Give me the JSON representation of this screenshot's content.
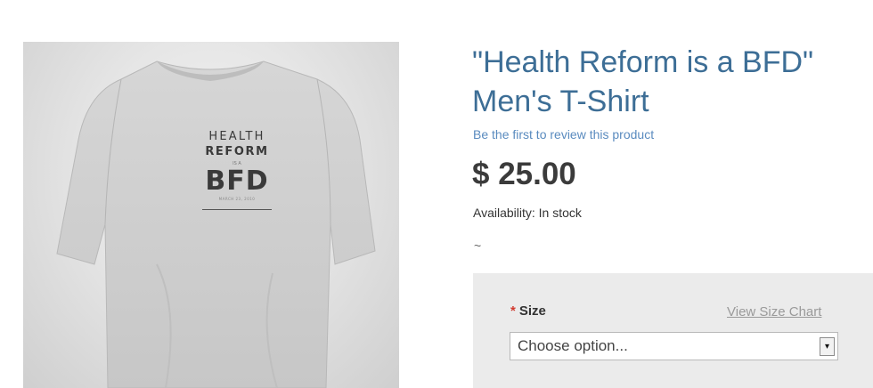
{
  "product": {
    "title_line1": "\"Health Reform is a BFD\"",
    "title_line2": "Men's T-Shirt",
    "review_link": "Be the first to review this product",
    "price": "$ 25.00",
    "availability": "Availability: In stock",
    "tilde": "~"
  },
  "shirt_print": {
    "line1": "HEALTH",
    "line2": "REFORM",
    "line3": "IS A",
    "line4": "BFD",
    "line5": "MARCH 23, 2010"
  },
  "options": {
    "size_label": "Size",
    "required_marker": "*",
    "size_chart_link": "View Size Chart",
    "size_select_value": "Choose option...",
    "select_arrow_icon": "▾"
  },
  "colors": {
    "title": "#3d6e96",
    "link": "#5a8bbf",
    "required": "#d13a2f",
    "panel": "#ebebeb"
  }
}
